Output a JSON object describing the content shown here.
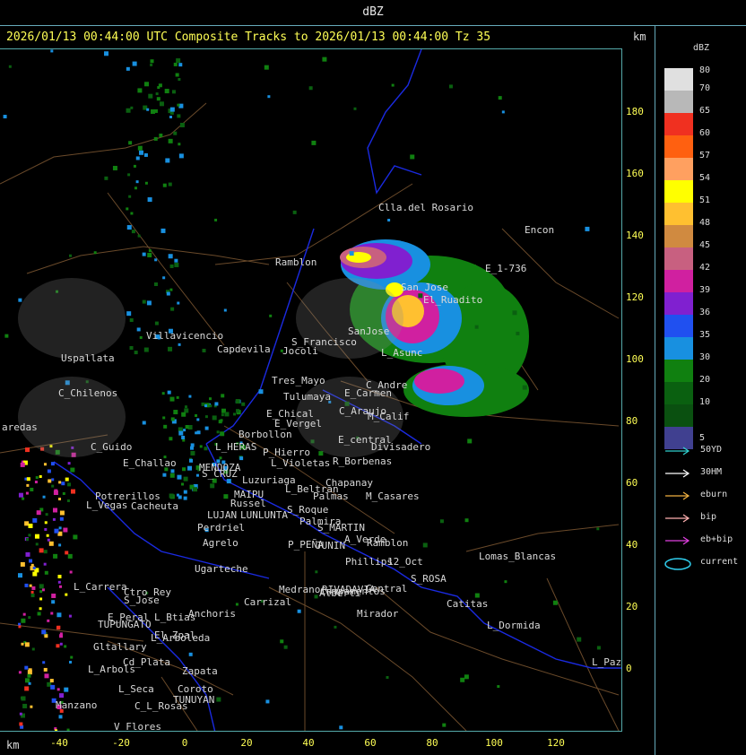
{
  "header": {
    "title": "dBZ"
  },
  "subtitle": "2026/01/13 00:44:00 UTC Composite Tracks to 2026/01/13 00:44:00 Tz 35",
  "axis_unit_top": "km",
  "axis_unit_bottom": "km",
  "y_ticks": [
    "180",
    "160",
    "140",
    "120",
    "100",
    "80",
    "60",
    "40",
    "20",
    "0"
  ],
  "x_ticks": [
    "-40",
    "-20",
    "0",
    "20",
    "40",
    "60",
    "80",
    "100",
    "120"
  ],
  "legend": {
    "title": "dBZ",
    "entries": [
      {
        "label": "80",
        "color": "#e0e0e0"
      },
      {
        "label": "70",
        "color": "#b8b8b8"
      },
      {
        "label": "65",
        "color": "#f03020"
      },
      {
        "label": "60",
        "color": "#ff6010"
      },
      {
        "label": "57",
        "color": "#ffa060"
      },
      {
        "label": "54",
        "color": "#ffff00"
      },
      {
        "label": "51",
        "color": "#ffc030"
      },
      {
        "label": "48",
        "color": "#d08a40"
      },
      {
        "label": "45",
        "color": "#c86080"
      },
      {
        "label": "42",
        "color": "#d020a0"
      },
      {
        "label": "39",
        "color": "#8020d0"
      },
      {
        "label": "36",
        "color": "#2050f0"
      },
      {
        "label": "35",
        "color": "#1890e0"
      },
      {
        "label": "30",
        "color": "#108010"
      },
      {
        "label": "20",
        "color": "#0a6010"
      },
      {
        "label": "10",
        "color": "#0a5010"
      },
      {
        "label": "5",
        "color": "#404090"
      }
    ],
    "tracks": [
      {
        "label": "50YD",
        "color": "#30d0d0"
      },
      {
        "label": "30HM",
        "color": "#ffffff"
      },
      {
        "label": "eburn",
        "color": "#f0b040"
      },
      {
        "label": "bip",
        "color": "#ffb0b0"
      },
      {
        "label": "eb+bip",
        "color": "#e040e0"
      },
      {
        "label": "current",
        "color": "#30d0f0"
      }
    ]
  },
  "map_labels": [
    "Clla.del Rosario",
    "Encon",
    "E_1-736",
    "Ramblon",
    "San Jose",
    "El_Ruadito",
    "SanJose",
    "S_Francisco",
    "Villavicencio",
    "Capdevila",
    "Jocoli",
    "L_Asunc",
    "Uspallata",
    "Tres_Mayo",
    "C_Andre",
    "C_Chilenos",
    "Tulumaya",
    "E_Carmen",
    "E_Chical",
    "E_Vergel",
    "C_Araujo",
    "M_Calif",
    "Borbollon",
    "E_central",
    "Divisadero",
    "C_Guido",
    "L_HERAS",
    "P_Hierro",
    "L_Violetas",
    "R_Borbenas",
    "E_Challao",
    "MENDOZA",
    "S_CRUZ",
    "Luzuriaga",
    "Chapanay",
    "Potrerillos",
    "L_Vegas",
    "Cacheuta",
    "MAIPU",
    "Russel",
    "L_Beltran",
    "Palmas",
    "M_Casares",
    "LUJAN",
    "LUNLUNTA",
    "S_Roque",
    "Palmira",
    "Perdriel",
    "S_MARTIN",
    "A_Verde",
    "Agrelo",
    "P_PEÑA",
    "JUNIN",
    "Ramblon",
    "Ugarteche",
    "Lomas_Blancas",
    "L_Carrera",
    "Ctro_Rey",
    "RIVADAVIA",
    "Phillips",
    "12_Oct",
    "S_Jose",
    "Carrizal",
    "Medrano",
    "Alberti",
    "S_ROSA",
    "Campamentos",
    "Central",
    "Catitas",
    "E_Peral",
    "TUPUNGATO",
    "L_Btias",
    "Anchoris",
    "Mirador",
    "L_Dormida",
    "El_Zpal",
    "L_Arboleda",
    "Gltallary",
    "Cd_Plata",
    "L_Paz",
    "L_Arbols",
    "Zapata",
    "L_Seca",
    "Coroto",
    "Manzano",
    "TUNUYAN",
    "C_L_Rosas",
    "V_Flores",
    "aredas"
  ]
}
